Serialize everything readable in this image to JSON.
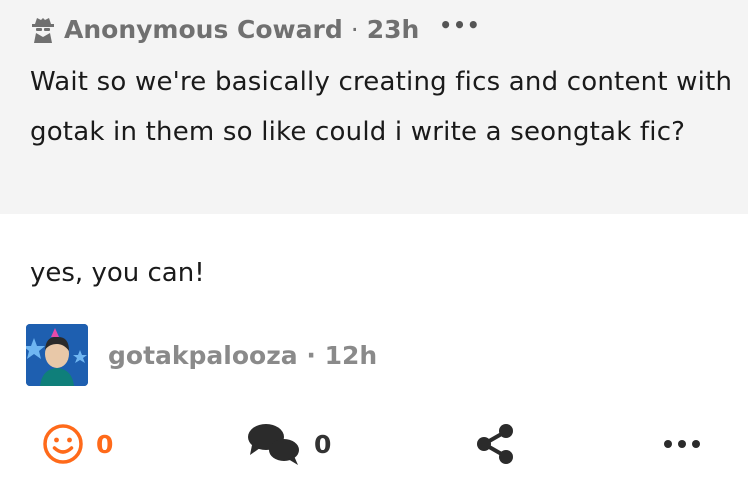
{
  "question": {
    "author": "Anonymous Coward",
    "separator": "·",
    "time": "23h",
    "more_label": "•••",
    "text": "Wait so we're basically creating fics and content with gotak in them so like could i write a seongtak fic?"
  },
  "answer": {
    "text": "yes, you can!",
    "author": "gotakpalooza",
    "separator": "·",
    "time": "12h"
  },
  "actions": {
    "react_count": "0",
    "comment_count": "0"
  },
  "colors": {
    "accent": "#ff6a1a",
    "question_bg": "#f4f4f4",
    "meta_text": "#707070"
  },
  "icons": [
    "anonymous-icon",
    "smiley-icon",
    "comments-icon",
    "share-icon",
    "more-icon"
  ]
}
